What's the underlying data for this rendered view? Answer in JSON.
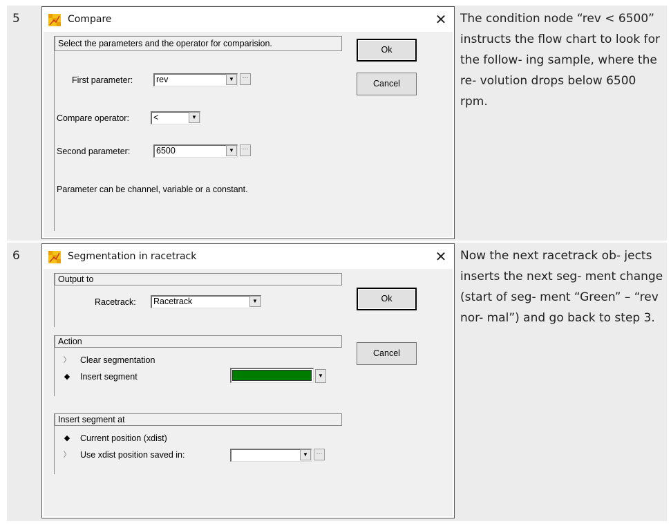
{
  "steps": [
    {
      "number": "5",
      "description": "The condition node “rev < 6500” instructs the flow chart to look for the follow- ing sample, where the re- volution drops below 6500 rpm.",
      "dialog": {
        "title": "Compare",
        "close_glyph": "✕",
        "instruction": "Select the parameters and the operator for comparision.",
        "ok_label": "Ok",
        "cancel_label": "Cancel",
        "first_parameter_label": "First parameter:",
        "first_parameter_value": "rev",
        "compare_operator_label": "Compare operator:",
        "compare_operator_value": "<",
        "second_parameter_label": "Second parameter:",
        "second_parameter_value": "6500",
        "hint": "Parameter can be channel, variable or a constant."
      }
    },
    {
      "number": "6",
      "description": "Now the next racetrack ob- jects inserts the next seg- ment change (start of seg- ment “Green” – “rev nor- mal”) and go back to step 3.",
      "dialog": {
        "title": "Segmentation in racetrack",
        "close_glyph": "✕",
        "ok_label": "Ok",
        "cancel_label": "Cancel",
        "output_group": "Output to",
        "racetrack_label": "Racetrack:",
        "racetrack_value": "Racetrack",
        "action_group": "Action",
        "clear_segmentation_label": "Clear segmentation",
        "insert_segment_label": "Insert segment",
        "segment_color": "#007c00",
        "insert_at_group": "Insert segment at",
        "current_position_label": "Current position (xdist)",
        "use_xdist_label": "Use xdist position saved in:",
        "xdist_value": ""
      }
    }
  ],
  "icons": {
    "dropdown": "▼",
    "ellipsis": "···",
    "radio_selected": "◆",
    "radio_unselected": "〉"
  }
}
